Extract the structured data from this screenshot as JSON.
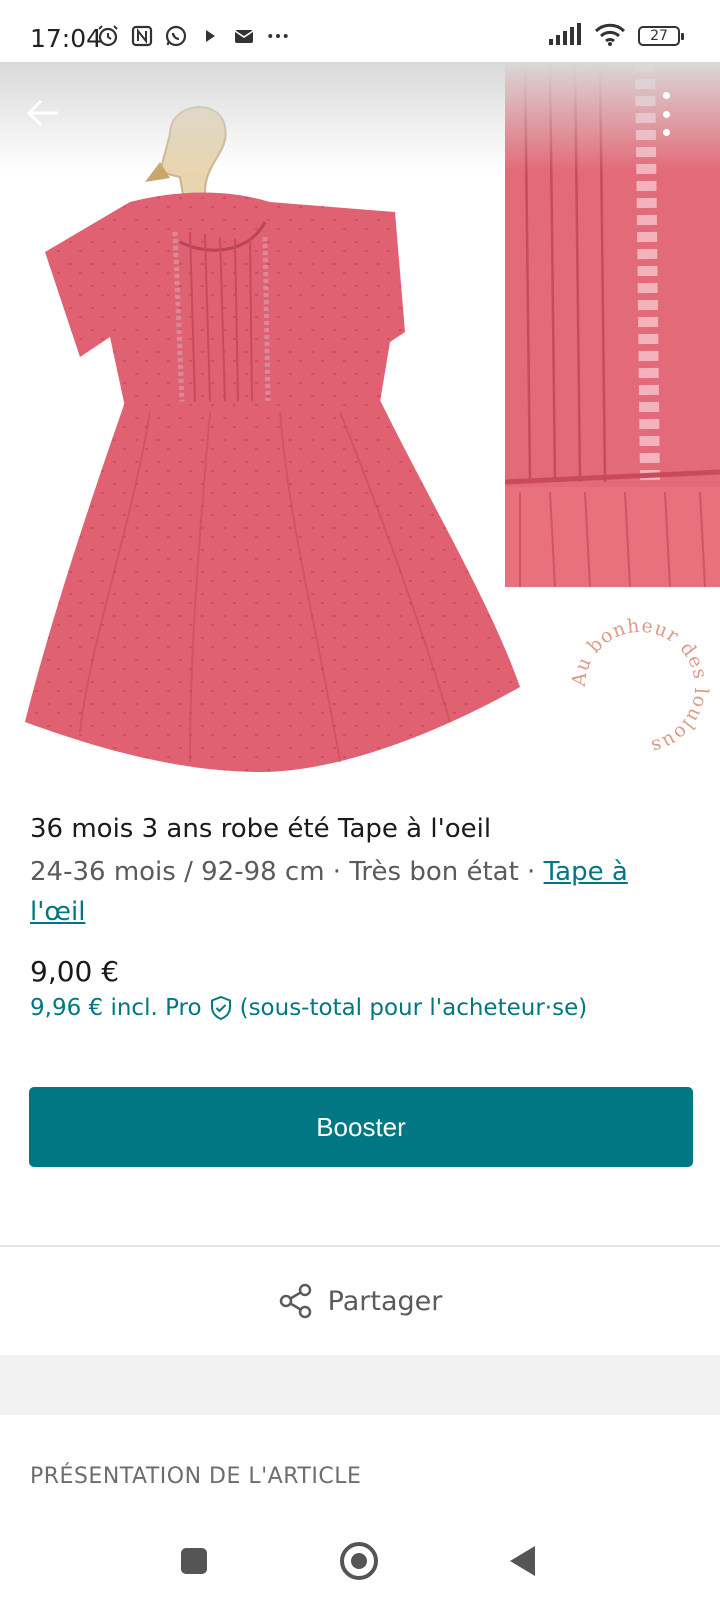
{
  "status_bar": {
    "time": "17:04",
    "battery": "27",
    "icons": [
      "alarm-icon",
      "nfc-icon",
      "whatsapp-icon",
      "play-icon",
      "mail-icon",
      "more-dots-icon",
      "signal-icon",
      "wifi-icon",
      "battery-icon"
    ]
  },
  "gallery": {
    "watermark_text": "Au bonheur des loulous"
  },
  "item": {
    "title": "36 mois 3 ans robe été Tape à l'oeil",
    "meta": "24-36 mois / 92-98 cm · Très bon état · ",
    "brand": "Tape à l'œil",
    "price": "9,00 €",
    "price_incl": "9,96 € incl. Pro",
    "price_incl_note": "(sous-total pour l'acheteur·se)"
  },
  "actions": {
    "booster_label": "Booster",
    "share_label": "Partager"
  },
  "sections": {
    "presentation_heading": "PRÉSENTATION DE L'ARTICLE"
  },
  "colors": {
    "accent": "#007782",
    "dress": "#e06272"
  }
}
